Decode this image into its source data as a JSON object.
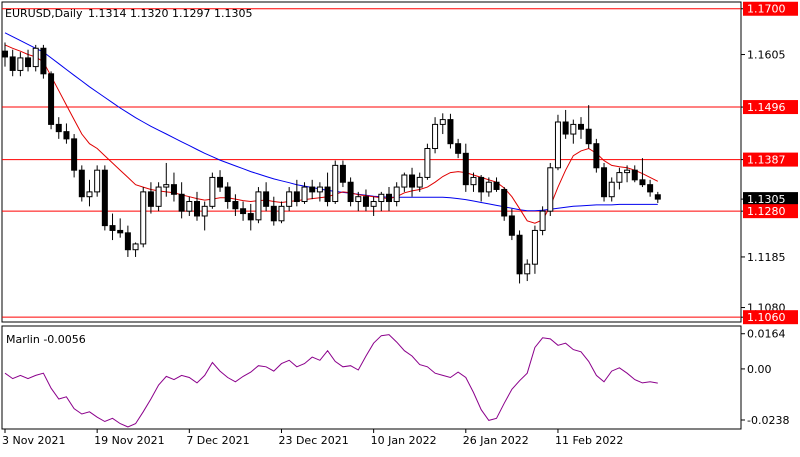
{
  "header": {
    "symbol_label": "EURUSD,Daily",
    "ohlc_label": "1.1314  1.1320  1.1297  1.1305"
  },
  "indicator": {
    "label": "Marlin -0.0056",
    "axis_labels": [
      "0.0164",
      "0.00",
      "-0.0238"
    ],
    "color": "#8b008b"
  },
  "colors": {
    "background": "#ffffff",
    "level_line": "#ff0000",
    "price_tag": "#ff0000",
    "ma_fast": "#e00000",
    "ma_slow": "#0000ee",
    "candle": "#000000",
    "current_price_tag": "#000000"
  },
  "chart_data": {
    "type": "candlestick",
    "price_axis_labels": [
      "1.1700",
      "1.1605",
      "1.1496",
      "1.1387",
      "1.1305",
      "1.1280",
      "1.1185",
      "1.1080",
      "1.1060"
    ],
    "levels": [
      {
        "value": 1.17,
        "label": "1.1700"
      },
      {
        "value": 1.1496,
        "label": "1.1496"
      },
      {
        "value": 1.1387,
        "label": "1.1387"
      },
      {
        "value": 1.128,
        "label": "1.1280"
      },
      {
        "value": 1.106,
        "label": "1.1060"
      }
    ],
    "current_price": {
      "value": 1.1305,
      "label": "1.1305"
    },
    "date_labels": [
      "3 Nov 2021",
      "19 Nov 2021",
      "7 Dec 2021",
      "23 Dec 2021",
      "10 Jan 2022",
      "26 Jan 2022",
      "11 Feb 2022"
    ],
    "date_label_index": [
      0,
      12,
      24,
      36,
      48,
      60,
      72
    ],
    "ohlc": [
      [
        1.1612,
        1.163,
        1.158,
        1.16
      ],
      [
        1.16,
        1.1615,
        1.156,
        1.1572
      ],
      [
        1.1572,
        1.161,
        1.156,
        1.1598
      ],
      [
        1.1598,
        1.1615,
        1.157,
        1.158
      ],
      [
        1.158,
        1.1625,
        1.157,
        1.1618
      ],
      [
        1.1618,
        1.1625,
        1.1555,
        1.1565
      ],
      [
        1.1565,
        1.157,
        1.145,
        1.146
      ],
      [
        1.146,
        1.1475,
        1.143,
        1.1445
      ],
      [
        1.1445,
        1.1462,
        1.142,
        1.143
      ],
      [
        1.143,
        1.144,
        1.135,
        1.1365
      ],
      [
        1.1365,
        1.1375,
        1.13,
        1.131
      ],
      [
        1.131,
        1.1345,
        1.129,
        1.132
      ],
      [
        1.132,
        1.1375,
        1.131,
        1.1365
      ],
      [
        1.1365,
        1.1375,
        1.124,
        1.125
      ],
      [
        1.125,
        1.1275,
        1.122,
        1.124
      ],
      [
        1.124,
        1.1265,
        1.1225,
        1.1235
      ],
      [
        1.1235,
        1.125,
        1.1185,
        1.12
      ],
      [
        1.12,
        1.1215,
        1.1185,
        1.1212
      ],
      [
        1.1212,
        1.133,
        1.1205,
        1.132
      ],
      [
        1.132,
        1.134,
        1.1275,
        1.129
      ],
      [
        1.129,
        1.134,
        1.128,
        1.133
      ],
      [
        1.133,
        1.138,
        1.131,
        1.1335
      ],
      [
        1.1335,
        1.136,
        1.13,
        1.1315
      ],
      [
        1.1315,
        1.134,
        1.1265,
        1.128
      ],
      [
        1.128,
        1.131,
        1.127,
        1.13
      ],
      [
        1.13,
        1.132,
        1.126,
        1.127
      ],
      [
        1.127,
        1.13,
        1.124,
        1.129
      ],
      [
        1.129,
        1.136,
        1.1285,
        1.135
      ],
      [
        1.135,
        1.1365,
        1.132,
        1.133
      ],
      [
        1.133,
        1.134,
        1.1285,
        1.13
      ],
      [
        1.13,
        1.1315,
        1.127,
        1.1285
      ],
      [
        1.1285,
        1.13,
        1.126,
        1.1275
      ],
      [
        1.1275,
        1.1295,
        1.124,
        1.1262
      ],
      [
        1.1262,
        1.133,
        1.1255,
        1.132
      ],
      [
        1.132,
        1.134,
        1.128,
        1.129
      ],
      [
        1.129,
        1.131,
        1.125,
        1.126
      ],
      [
        1.126,
        1.13,
        1.1255,
        1.129
      ],
      [
        1.129,
        1.133,
        1.128,
        1.132
      ],
      [
        1.132,
        1.1345,
        1.129,
        1.13
      ],
      [
        1.13,
        1.134,
        1.1295,
        1.133
      ],
      [
        1.133,
        1.1345,
        1.1305,
        1.132
      ],
      [
        1.132,
        1.134,
        1.13,
        1.133
      ],
      [
        1.133,
        1.136,
        1.129,
        1.13
      ],
      [
        1.13,
        1.1385,
        1.1295,
        1.1375
      ],
      [
        1.1375,
        1.1385,
        1.133,
        1.134
      ],
      [
        1.134,
        1.135,
        1.129,
        1.13
      ],
      [
        1.13,
        1.132,
        1.128,
        1.131
      ],
      [
        1.131,
        1.1325,
        1.128,
        1.129
      ],
      [
        1.129,
        1.131,
        1.127,
        1.13
      ],
      [
        1.13,
        1.132,
        1.128,
        1.1315
      ],
      [
        1.1315,
        1.133,
        1.128,
        1.13
      ],
      [
        1.13,
        1.134,
        1.129,
        1.133
      ],
      [
        1.133,
        1.136,
        1.132,
        1.1355
      ],
      [
        1.1355,
        1.137,
        1.131,
        1.133
      ],
      [
        1.133,
        1.136,
        1.132,
        1.135
      ],
      [
        1.135,
        1.142,
        1.1345,
        1.141
      ],
      [
        1.141,
        1.1475,
        1.14,
        1.146
      ],
      [
        1.146,
        1.1483,
        1.144,
        1.147
      ],
      [
        1.147,
        1.1482,
        1.141,
        1.142
      ],
      [
        1.142,
        1.143,
        1.139,
        1.14
      ],
      [
        1.14,
        1.142,
        1.132,
        1.1335
      ],
      [
        1.1335,
        1.136,
        1.132,
        1.135
      ],
      [
        1.135,
        1.1355,
        1.13,
        1.132
      ],
      [
        1.132,
        1.135,
        1.131,
        1.134
      ],
      [
        1.134,
        1.135,
        1.132,
        1.1325
      ],
      [
        1.1325,
        1.133,
        1.126,
        1.127
      ],
      [
        1.127,
        1.1285,
        1.122,
        1.123
      ],
      [
        1.123,
        1.124,
        1.113,
        1.115
      ],
      [
        1.115,
        1.118,
        1.1135,
        1.117
      ],
      [
        1.117,
        1.125,
        1.115,
        1.124
      ],
      [
        1.124,
        1.129,
        1.123,
        1.128
      ],
      [
        1.128,
        1.138,
        1.127,
        1.137
      ],
      [
        1.137,
        1.148,
        1.1365,
        1.1465
      ],
      [
        1.1465,
        1.149,
        1.143,
        1.144
      ],
      [
        1.144,
        1.147,
        1.142,
        1.146
      ],
      [
        1.146,
        1.1475,
        1.143,
        1.145
      ],
      [
        1.145,
        1.15,
        1.141,
        1.142
      ],
      [
        1.142,
        1.143,
        1.136,
        1.137
      ],
      [
        1.137,
        1.138,
        1.13,
        1.131
      ],
      [
        1.131,
        1.135,
        1.13,
        1.134
      ],
      [
        1.134,
        1.137,
        1.1325,
        1.136
      ],
      [
        1.136,
        1.1375,
        1.134,
        1.1365
      ],
      [
        1.1365,
        1.1375,
        1.134,
        1.1345
      ],
      [
        1.1345,
        1.139,
        1.133,
        1.1335
      ],
      [
        1.1335,
        1.1345,
        1.131,
        1.132
      ],
      [
        1.1314,
        1.132,
        1.1297,
        1.1305
      ]
    ],
    "ma_fast": [
      1.1625,
      1.1618,
      1.1612,
      1.1605,
      1.16,
      1.159,
      1.156,
      1.153,
      1.15,
      1.147,
      1.144,
      1.142,
      1.141,
      1.1395,
      1.138,
      1.1365,
      1.135,
      1.1335,
      1.133,
      1.1325,
      1.1322,
      1.132,
      1.1318,
      1.1314,
      1.131,
      1.1306,
      1.1303,
      1.1305,
      1.1308,
      1.1308,
      1.1305,
      1.1302,
      1.13,
      1.1302,
      1.1303,
      1.13,
      1.1298,
      1.13,
      1.1302,
      1.1304,
      1.1306,
      1.1308,
      1.131,
      1.1315,
      1.132,
      1.1318,
      1.1314,
      1.1312,
      1.131,
      1.1308,
      1.1306,
      1.131,
      1.1318,
      1.1322,
      1.1325,
      1.133,
      1.134,
      1.1352,
      1.136,
      1.1362,
      1.136,
      1.1355,
      1.135,
      1.1345,
      1.134,
      1.1328,
      1.131,
      1.1285,
      1.126,
      1.1255,
      1.1262,
      1.129,
      1.133,
      1.1365,
      1.1395,
      1.1405,
      1.141,
      1.14,
      1.1385,
      1.1375,
      1.1372,
      1.137,
      1.1365,
      1.1358,
      1.135,
      1.1342
    ],
    "ma_slow": [
      1.165,
      1.1642,
      1.1634,
      1.1626,
      1.1618,
      1.161,
      1.1598,
      1.1586,
      1.1574,
      1.1562,
      1.155,
      1.1538,
      1.1527,
      1.1516,
      1.1505,
      1.1494,
      1.1484,
      1.1474,
      1.1465,
      1.1456,
      1.1448,
      1.144,
      1.1432,
      1.1424,
      1.1416,
      1.1408,
      1.14,
      1.1393,
      1.1386,
      1.138,
      1.1374,
      1.1368,
      1.1362,
      1.1357,
      1.1352,
      1.1347,
      1.1343,
      1.1339,
      1.1335,
      1.1332,
      1.1329,
      1.1326,
      1.1323,
      1.1321,
      1.1319,
      1.1317,
      1.1315,
      1.1313,
      1.1311,
      1.131,
      1.1309,
      1.1309,
      1.1309,
      1.1309,
      1.1309,
      1.1309,
      1.1309,
      1.1309,
      1.1308,
      1.1306,
      1.1304,
      1.1301,
      1.1298,
      1.1295,
      1.1292,
      1.1289,
      1.1286,
      1.1283,
      1.1281,
      1.1281,
      1.1282,
      1.1284,
      1.1286,
      1.1288,
      1.129,
      1.1291,
      1.1292,
      1.1293,
      1.1293,
      1.1293,
      1.1294,
      1.1294,
      1.1294,
      1.1294,
      1.1294,
      1.1294
    ],
    "price_range": [
      1.105,
      1.1714
    ],
    "indicator_values": [
      -0.002,
      -0.0045,
      -0.003,
      -0.0045,
      -0.003,
      -0.002,
      -0.009,
      -0.014,
      -0.013,
      -0.0185,
      -0.021,
      -0.02,
      -0.0225,
      -0.0245,
      -0.023,
      -0.0255,
      -0.027,
      -0.0255,
      -0.02,
      -0.014,
      -0.0075,
      -0.0035,
      -0.005,
      -0.003,
      -0.004,
      -0.0065,
      -0.003,
      0.003,
      -0.001,
      -0.004,
      -0.006,
      -0.0035,
      -0.0015,
      0.0015,
      0.001,
      -0.001,
      0.0025,
      0.004,
      0.001,
      0.0025,
      0.0055,
      0.004,
      0.0085,
      0.0035,
      0.001,
      0.0015,
      -0.0005,
      0.006,
      0.012,
      0.0155,
      0.016,
      0.0125,
      0.0085,
      0.006,
      0.002,
      0.001,
      -0.002,
      -0.003,
      -0.004,
      -0.0015,
      -0.004,
      -0.011,
      -0.019,
      -0.024,
      -0.023,
      -0.016,
      -0.0095,
      -0.0055,
      -0.002,
      0.01,
      0.0145,
      0.014,
      0.011,
      0.012,
      0.009,
      0.008,
      0.0035,
      -0.003,
      -0.006,
      -0.001,
      0.0005,
      -0.002,
      -0.005,
      -0.0065,
      -0.006,
      -0.0066
    ],
    "indicator_range": [
      -0.028,
      0.02
    ]
  }
}
